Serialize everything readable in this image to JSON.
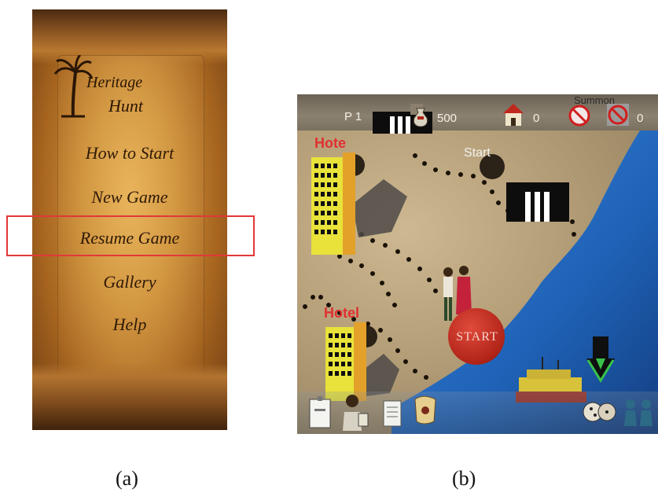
{
  "panel_a": {
    "logo": {
      "line1": "Heritage",
      "line2": "Hunt"
    },
    "menu": [
      {
        "label": "How to Start"
      },
      {
        "label": "New Game"
      },
      {
        "label": "Resume Game"
      },
      {
        "label": "Gallery"
      },
      {
        "label": "Help"
      }
    ],
    "caption": "(a)"
  },
  "panel_b": {
    "hud": {
      "player": "P 1",
      "money": "500",
      "houses": "0",
      "penalty_count": "0",
      "top_right_label": "Summon"
    },
    "labels": {
      "hotel_top": "Hote",
      "start_small": "Start",
      "hotel_bottom": "Hotel",
      "start_big": "START"
    },
    "caption": "(b)"
  },
  "colors": {
    "highlight": "#e23838",
    "parchment": "#c98a34",
    "water": "#1f63b8",
    "sand": "#b6a07a"
  }
}
